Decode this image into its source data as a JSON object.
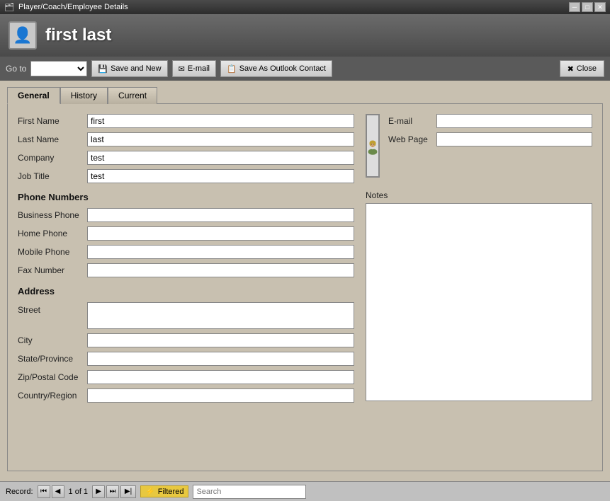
{
  "window": {
    "title": "Player/Coach/Employee Details",
    "min_btn": "─",
    "max_btn": "□",
    "close_btn": "✕"
  },
  "header": {
    "title": "first last",
    "icon_label": "👤"
  },
  "toolbar": {
    "goto_label": "Go to",
    "goto_placeholder": "",
    "save_new_label": "Save and New",
    "email_btn_label": "E-mail",
    "outlook_btn_label": "Save As Outlook Contact",
    "close_label": "Close"
  },
  "tabs": [
    {
      "id": "general",
      "label": "General",
      "active": true
    },
    {
      "id": "history",
      "label": "History",
      "active": false
    },
    {
      "id": "current",
      "label": "Current",
      "active": false
    }
  ],
  "form": {
    "first_name_label": "First Name",
    "first_name_value": "first",
    "last_name_label": "Last Name",
    "last_name_value": "last",
    "company_label": "Company",
    "company_value": "test",
    "job_title_label": "Job Title",
    "job_title_value": "test",
    "phone_section": "Phone Numbers",
    "business_phone_label": "Business Phone",
    "business_phone_value": "",
    "home_phone_label": "Home Phone",
    "home_phone_value": "",
    "mobile_phone_label": "Mobile Phone",
    "mobile_phone_value": "",
    "fax_number_label": "Fax Number",
    "fax_number_value": "",
    "address_section": "Address",
    "street_label": "Street",
    "street_value": "",
    "city_label": "City",
    "city_value": "",
    "state_label": "State/Province",
    "state_value": "",
    "zip_label": "Zip/Postal Code",
    "zip_value": "",
    "country_label": "Country/Region",
    "country_value": "",
    "email_label": "E-mail",
    "email_value": "",
    "webpage_label": "Web Page",
    "webpage_value": "",
    "notes_label": "Notes"
  },
  "status": {
    "record_label": "Record:",
    "first_nav": "⏮",
    "prev_nav": "◀",
    "record_text": "1 of 1",
    "next_nav": "▶",
    "last_nav": "⏭",
    "new_nav": "▶|",
    "filtered_icon": "⚡",
    "filtered_label": "Filtered",
    "search_placeholder": "Search",
    "search_label": "Search"
  }
}
